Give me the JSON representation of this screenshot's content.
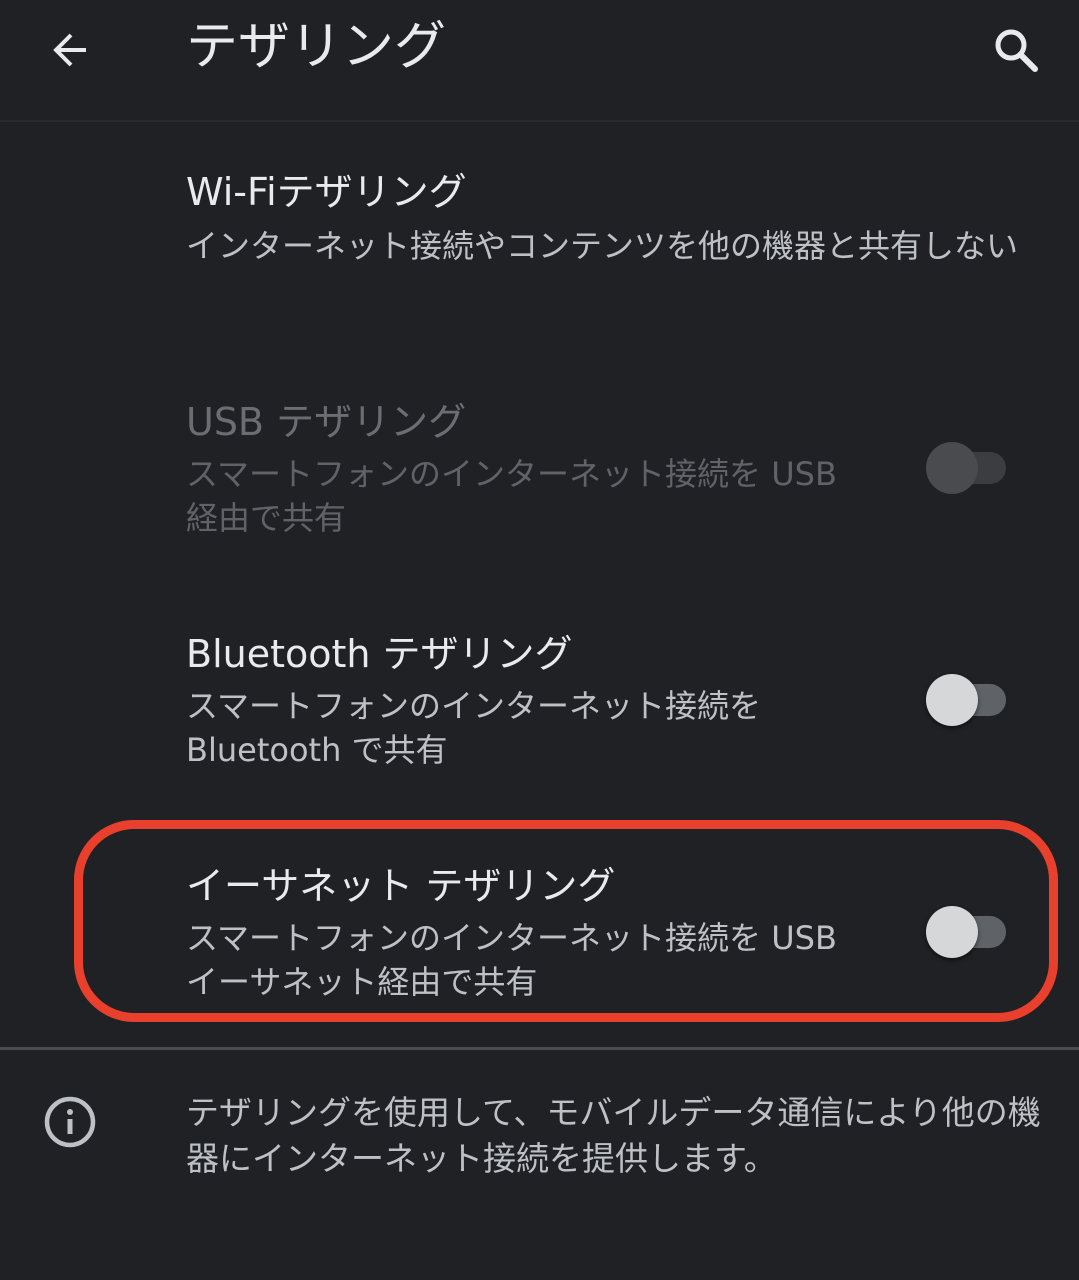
{
  "appbar": {
    "title": "テザリング",
    "back_icon": "arrow-back-icon",
    "search_icon": "search-icon"
  },
  "preferences": {
    "wifi": {
      "title": "Wi-Fiテザリング",
      "summary": "インターネット接続やコンテンツを他の機器と共有しない"
    },
    "usb": {
      "title": "USB テザリング",
      "summary": "スマートフォンのインターネット接続を USB 経由で共有",
      "enabled": false,
      "checked": false
    },
    "bluetooth": {
      "title": "Bluetooth テザリング",
      "summary": "スマートフォンのインターネット接続を Bluetooth で共有",
      "enabled": true,
      "checked": false
    },
    "ethernet": {
      "title": "イーサネット テザリング",
      "summary": "スマートフォンのインターネット接続を USB イーサネット経由で共有",
      "enabled": true,
      "checked": false
    }
  },
  "footer": {
    "info_icon": "info-icon",
    "text": "テザリングを使用して、モバイルデータ通信により他の機器にインターネット接続を提供します。"
  },
  "colors": {
    "background": "#202124",
    "highlight": "#e8402c"
  }
}
